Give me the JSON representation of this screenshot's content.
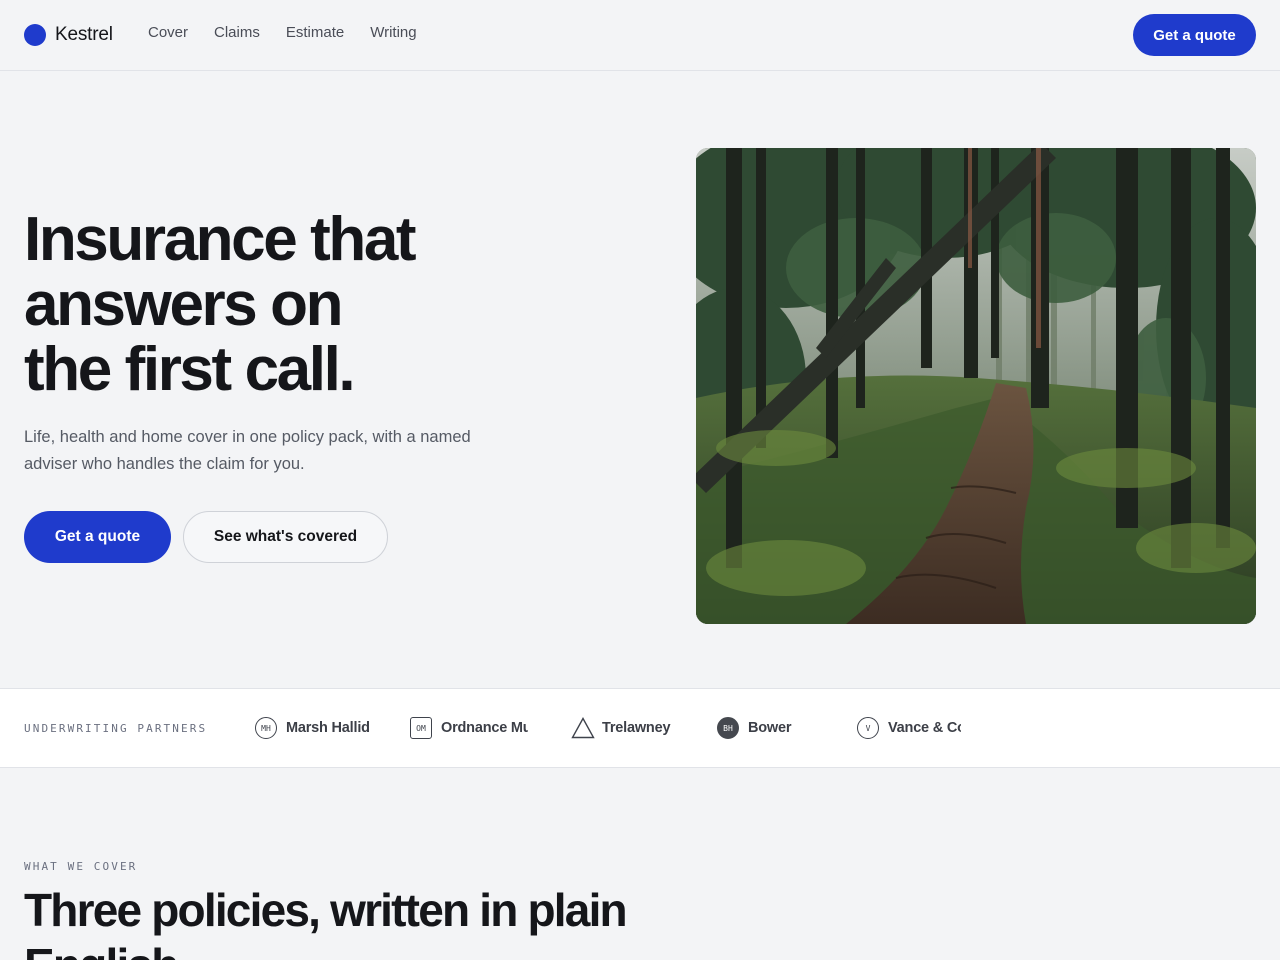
{
  "brand": {
    "name": "Kestrel",
    "accent": "#1f3bcc"
  },
  "nav": {
    "links": [
      "Cover",
      "Claims",
      "Estimate",
      "Writing"
    ],
    "cta": "Get a quote"
  },
  "hero": {
    "title_lines": [
      "Insurance that",
      "answers on",
      "the first call."
    ],
    "subtitle": "Life, health and home cover in one policy pack, with a named adviser who handles the claim for you.",
    "primary_cta": "Get a quote",
    "secondary_cta": "See what's covered",
    "image": "forest-path-photo"
  },
  "partners": {
    "label": "UNDERWRITING PARTNERS",
    "items": [
      {
        "name": "Marsh Hallid",
        "initials": "MH",
        "icon": "circle-outline-icon"
      },
      {
        "name": "Ordnance Mu",
        "initials": "OM",
        "icon": "square-outline-icon"
      },
      {
        "name": "Trelawney",
        "initials": "",
        "icon": "triangle-outline-icon"
      },
      {
        "name": "Bower",
        "initials": "BH",
        "icon": "circle-filled-icon"
      },
      {
        "name": "Vance & Co",
        "initials": "V",
        "icon": "circle-outline-icon"
      }
    ]
  },
  "coverage": {
    "eyebrow": "WHAT WE COVER",
    "title": "Three policies, written in plain English."
  }
}
